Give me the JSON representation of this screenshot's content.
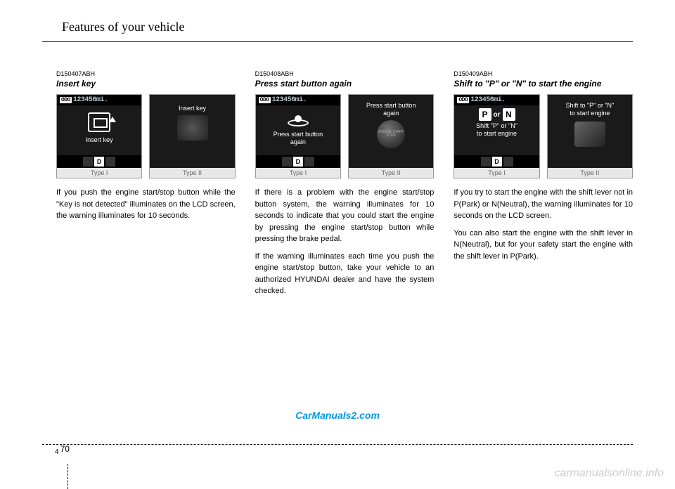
{
  "header": "Features of your vehicle",
  "page": {
    "section": "4",
    "number": "70"
  },
  "watermarks": {
    "w1": "CarManuals2.com",
    "w2": "carmanualsonline.info"
  },
  "odo": {
    "label": "ODO",
    "value": "123456",
    "unit": "mi."
  },
  "type_labels": {
    "t1": "Type I",
    "t2": "Type II"
  },
  "gear": {
    "active": "D"
  },
  "button_text": "ENGINE START STOP",
  "cols": [
    {
      "code": "D150407ABH",
      "title": "Insert key",
      "screen1_line1": "Insert key",
      "screen2_line1": "Insert key",
      "paras": [
        "If you push the engine start/stop button while the \"Key is not detected\" illuminates on the LCD screen, the warning illuminates for 10 seconds."
      ]
    },
    {
      "code": "D150408ABH",
      "title": "Press start button again",
      "screen1_line1": "Press start button",
      "screen1_line2": "again",
      "screen2_line1": "Press start button",
      "screen2_line2": "again",
      "paras": [
        "If there is a problem with the engine start/stop button system, the warning illuminates for 10 seconds to indicate that you could start the engine by pressing the engine start/stop button while pressing the brake pedal.",
        "If the warning illuminates each time you push the engine start/stop button, take your vehicle to an authorized HYUNDAI dealer and have the system checked."
      ]
    },
    {
      "code": "D150409ABH",
      "title": "Shift to \"P\" or \"N\" to start the engine",
      "screen1_line1": "Shift \"P\" or \"N\"",
      "screen1_line2": "to start engine",
      "screen2_line1": "Shift to \"P\" or \"N\"",
      "screen2_line2": "to start engine",
      "pn_or": "or",
      "paras": [
        "If you try to start the engine with the shift lever not in P(Park) or N(Neutral), the warning illuminates for 10 seconds on the LCD screen.",
        "You can also start the engine with the shift lever in N(Neutral), but for your safety start the engine with the shift lever in P(Park)."
      ]
    }
  ]
}
